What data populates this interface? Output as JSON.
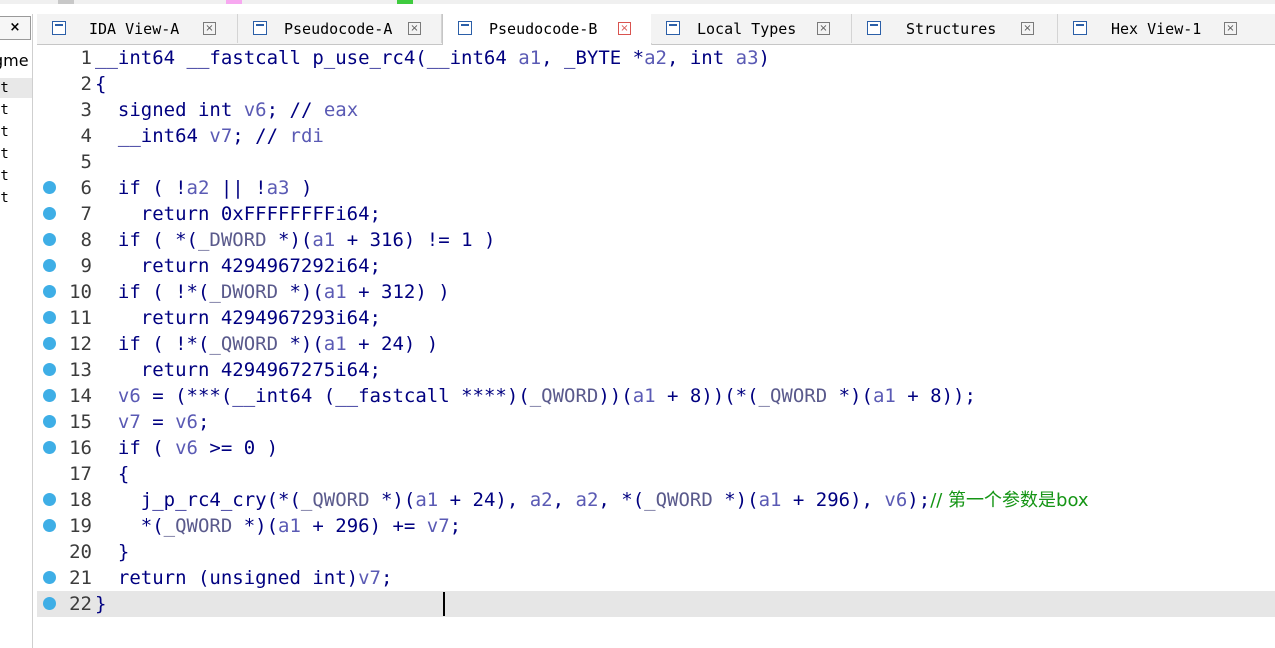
{
  "left_panel": {
    "close_label": "×",
    "header": "gme",
    "rows": [
      "xt",
      "xt",
      "xt",
      "xt",
      "xt",
      "xt"
    ]
  },
  "tabs": [
    {
      "label": "IDA View-A",
      "close": "×",
      "active": false,
      "icon": "ida-view-icon"
    },
    {
      "label": "Pseudocode-A",
      "close": "×",
      "active": false,
      "icon": "pseudocode-icon"
    },
    {
      "label": "Pseudocode-B",
      "close": "×",
      "active": true,
      "icon": "pseudocode-icon"
    },
    {
      "label": "Local Types",
      "close": "×",
      "active": false,
      "icon": "local-types-icon"
    },
    {
      "label": "Structures",
      "close": "×",
      "active": false,
      "icon": "structures-icon"
    },
    {
      "label": "Hex View-1",
      "close": "×",
      "active": false,
      "icon": "hex-view-icon"
    }
  ],
  "code": {
    "current_line": 22,
    "lines": [
      {
        "n": "1",
        "bp": false,
        "text": "__int64 __fastcall p_use_rc4(__int64 a1, _BYTE *a2, int a3)"
      },
      {
        "n": "2",
        "bp": false,
        "text": "{"
      },
      {
        "n": "3",
        "bp": false,
        "text": "  signed int v6; // eax"
      },
      {
        "n": "4",
        "bp": false,
        "text": "  __int64 v7; // rdi"
      },
      {
        "n": "5",
        "bp": false,
        "text": ""
      },
      {
        "n": "6",
        "bp": true,
        "text": "  if ( !a2 || !a3 )"
      },
      {
        "n": "7",
        "bp": true,
        "text": "    return 0xFFFFFFFFi64;"
      },
      {
        "n": "8",
        "bp": true,
        "text": "  if ( *(_DWORD *)(a1 + 316) != 1 )"
      },
      {
        "n": "9",
        "bp": true,
        "text": "    return 4294967292i64;"
      },
      {
        "n": "10",
        "bp": true,
        "text": "  if ( !*(_DWORD *)(a1 + 312) )"
      },
      {
        "n": "11",
        "bp": true,
        "text": "    return 4294967293i64;"
      },
      {
        "n": "12",
        "bp": true,
        "text": "  if ( !*(_QWORD *)(a1 + 24) )"
      },
      {
        "n": "13",
        "bp": true,
        "text": "    return 4294967275i64;"
      },
      {
        "n": "14",
        "bp": true,
        "text": "  v6 = (***(__int64 (__fastcall ****)(_QWORD))(a1 + 8))(*(_QWORD *)(a1 + 8));"
      },
      {
        "n": "15",
        "bp": true,
        "text": "  v7 = v6;"
      },
      {
        "n": "16",
        "bp": true,
        "text": "  if ( v6 >= 0 )"
      },
      {
        "n": "17",
        "bp": false,
        "text": "  {"
      },
      {
        "n": "18",
        "bp": true,
        "text": "    j_p_rc4_cry(*(_QWORD *)(a1 + 24), a2, a2, *(_QWORD *)(a1 + 296), v6);// 第一个参数是box"
      },
      {
        "n": "19",
        "bp": true,
        "text": "    *(_QWORD *)(a1 + 296) += v7;"
      },
      {
        "n": "20",
        "bp": false,
        "text": "  }"
      },
      {
        "n": "21",
        "bp": true,
        "text": "  return (unsigned int)v7;"
      },
      {
        "n": "22",
        "bp": true,
        "text": "}"
      }
    ]
  },
  "colors": {
    "keyword": "#000080",
    "variable": "#5a5ab4",
    "comment": "#159515",
    "breakpoint": "#3eaee6",
    "current_line": "#e6e6e6"
  }
}
